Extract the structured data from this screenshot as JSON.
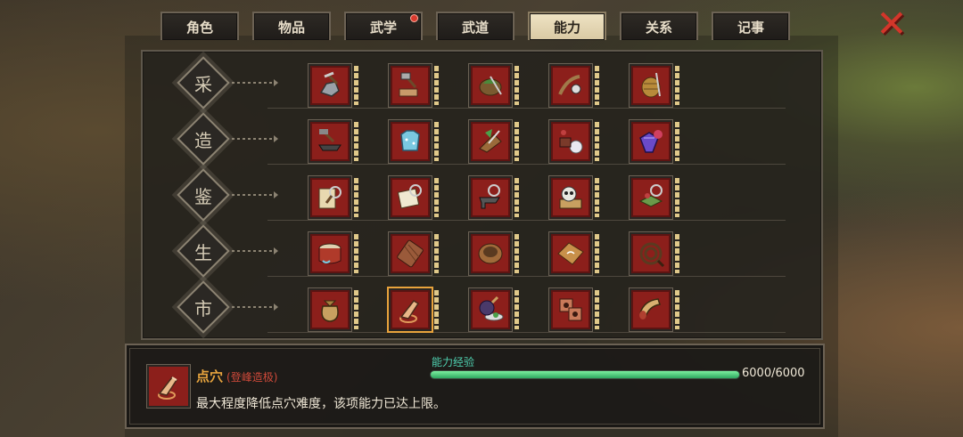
{
  "tabs": [
    {
      "label": "角色",
      "active": false,
      "badge": false
    },
    {
      "label": "物品",
      "active": false,
      "badge": false
    },
    {
      "label": "武学",
      "active": false,
      "badge": true
    },
    {
      "label": "武道",
      "active": false,
      "badge": false
    },
    {
      "label": "能力",
      "active": true,
      "badge": false
    },
    {
      "label": "关系",
      "active": false,
      "badge": false
    },
    {
      "label": "记事",
      "active": false,
      "badge": false
    }
  ],
  "close_icon": "close-x-icon",
  "rows": [
    {
      "label": "采",
      "skills": [
        "mining-icon",
        "woodcutting-icon",
        "herb-gathering-icon",
        "fishing-icon",
        "weaving-icon"
      ]
    },
    {
      "label": "造",
      "skills": [
        "forging-icon",
        "tailoring-icon",
        "herb-cutting-icon",
        "alchemy-icon",
        "gem-crafting-icon"
      ]
    },
    {
      "label": "鉴",
      "skills": [
        "scroll-appraisal-icon",
        "document-appraisal-icon",
        "anvil-appraisal-icon",
        "skull-appraisal-icon",
        "item-appraisal-icon"
      ]
    },
    {
      "label": "生",
      "skills": [
        "drum-icon",
        "chopping-board-icon",
        "basket-icon",
        "pastry-icon",
        "whip-icon"
      ]
    },
    {
      "label": "市",
      "skills": [
        "money-bag-icon",
        "acupoint-finger-icon",
        "potion-icon",
        "gears-icon",
        "horn-icon"
      ]
    }
  ],
  "selected": {
    "row": 4,
    "col": 1
  },
  "info": {
    "icon": "acupoint-finger-icon",
    "title": "点穴",
    "subtitle": "(登峰造极)",
    "description": "最大程度降低点穴难度，该项能力已达上限。",
    "exp_label": "能力经验",
    "exp_current": 6000,
    "exp_max": 6000,
    "exp_text": "6000/6000"
  },
  "colors": {
    "accent_gold": "#e7a43e",
    "skill_bg": "#8c1f1b",
    "exp_green": "#2ea860",
    "close_red": "#d2362a"
  }
}
